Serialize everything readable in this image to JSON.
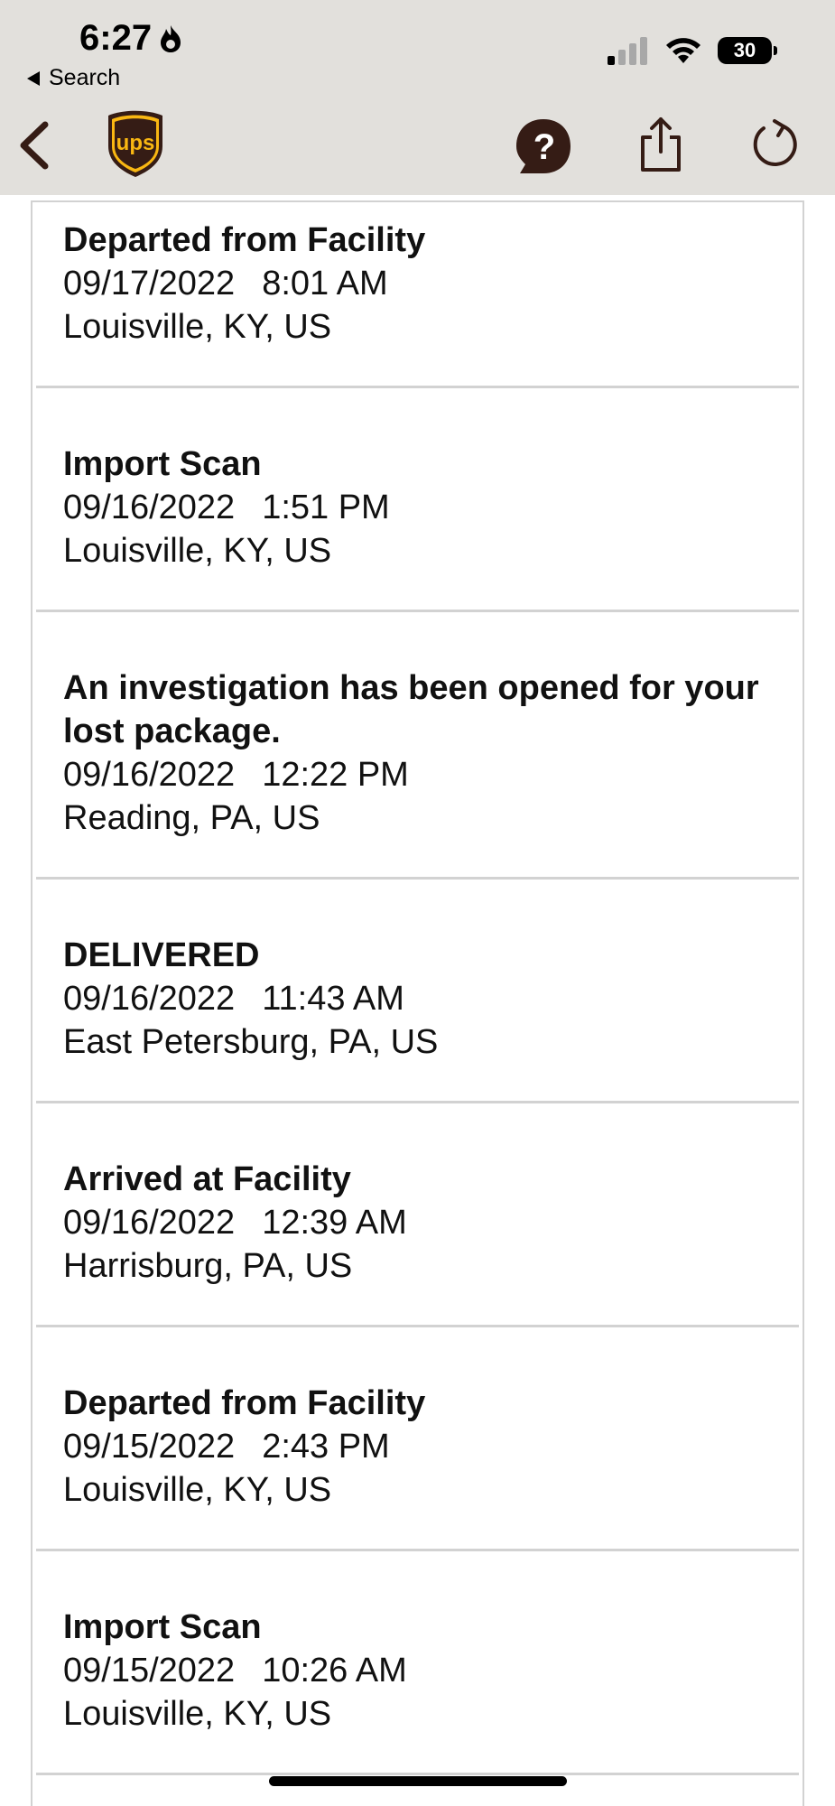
{
  "status_bar": {
    "time": "6:27",
    "back_label": "Search",
    "battery": "30"
  },
  "colors": {
    "brown": "#351c15",
    "gold": "#f9b712",
    "topbar_bg": "#e2e0dc",
    "divider": "#d2d2d2"
  },
  "nav": {
    "back_icon": "chevron-left-icon",
    "logo": "ups-logo",
    "help_icon": "help-bubble-icon",
    "share_icon": "share-icon",
    "refresh_icon": "refresh-icon",
    "logo_text": "ups"
  },
  "events": [
    {
      "title": "Departed from Facility",
      "date": "09/17/2022",
      "time": "8:01 AM",
      "location": "Louisville, KY, US"
    },
    {
      "title": "Import Scan",
      "date": "09/16/2022",
      "time": "1:51 PM",
      "location": "Louisville, KY, US"
    },
    {
      "title": "An investigation has been opened for your lost package.",
      "date": "09/16/2022",
      "time": "12:22 PM",
      "location": "Reading, PA, US"
    },
    {
      "title": "DELIVERED",
      "date": "09/16/2022",
      "time": "11:43 AM",
      "location": "East Petersburg, PA, US"
    },
    {
      "title": "Arrived at Facility",
      "date": "09/16/2022",
      "time": "12:39 AM",
      "location": "Harrisburg, PA, US"
    },
    {
      "title": "Departed from Facility",
      "date": "09/15/2022",
      "time": "2:43 PM",
      "location": "Louisville, KY, US"
    },
    {
      "title": "Import Scan",
      "date": "09/15/2022",
      "time": "10:26 AM",
      "location": "Louisville, KY, US"
    }
  ]
}
